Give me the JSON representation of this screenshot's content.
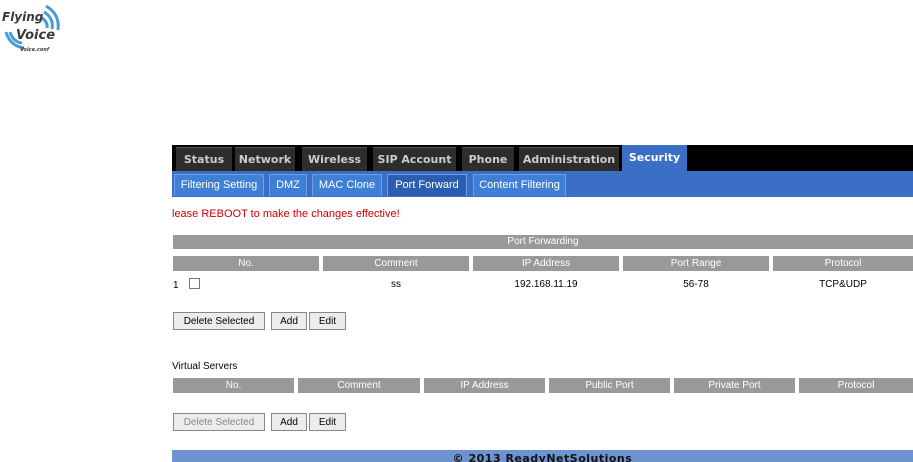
{
  "logo": {
    "line1": "Flying",
    "line2": "Voice",
    "line3": "Voice.conf"
  },
  "main_tabs": [
    "Status",
    "Network",
    "Wireless",
    "SIP Account",
    "Phone",
    "Administration",
    "Security"
  ],
  "sub_tabs": [
    "Filtering Setting",
    "DMZ",
    "MAC Clone",
    "Port Forward",
    "Content Filtering"
  ],
  "reboot_notice": "lease REBOOT to make the changes effective!",
  "port_forwarding": {
    "title": "Port Forwarding",
    "headers": [
      "No.",
      "Comment",
      "IP Address",
      "Port Range",
      "Protocol"
    ],
    "rows": [
      {
        "no": "1",
        "comment": "ss",
        "ip": "192.168.11.19",
        "port_range": "56-78",
        "protocol": "TCP&UDP"
      }
    ],
    "buttons": {
      "delete": "Delete Selected",
      "add": "Add",
      "edit": "Edit"
    }
  },
  "virtual_servers": {
    "title": "Virtual Servers",
    "headers": [
      "No.",
      "Comment",
      "IP Address",
      "Public Port",
      "Private Port",
      "Protocol"
    ],
    "buttons": {
      "delete": "Delete Selected",
      "add": "Add",
      "edit": "Edit"
    }
  },
  "footer": "© 2013 ReadyNetSolutions",
  "colors": {
    "tab_active": "#3b6fc6",
    "header_gray": "#999999",
    "notice_red": "#d00000",
    "footer_blue": "#6d93d0"
  }
}
